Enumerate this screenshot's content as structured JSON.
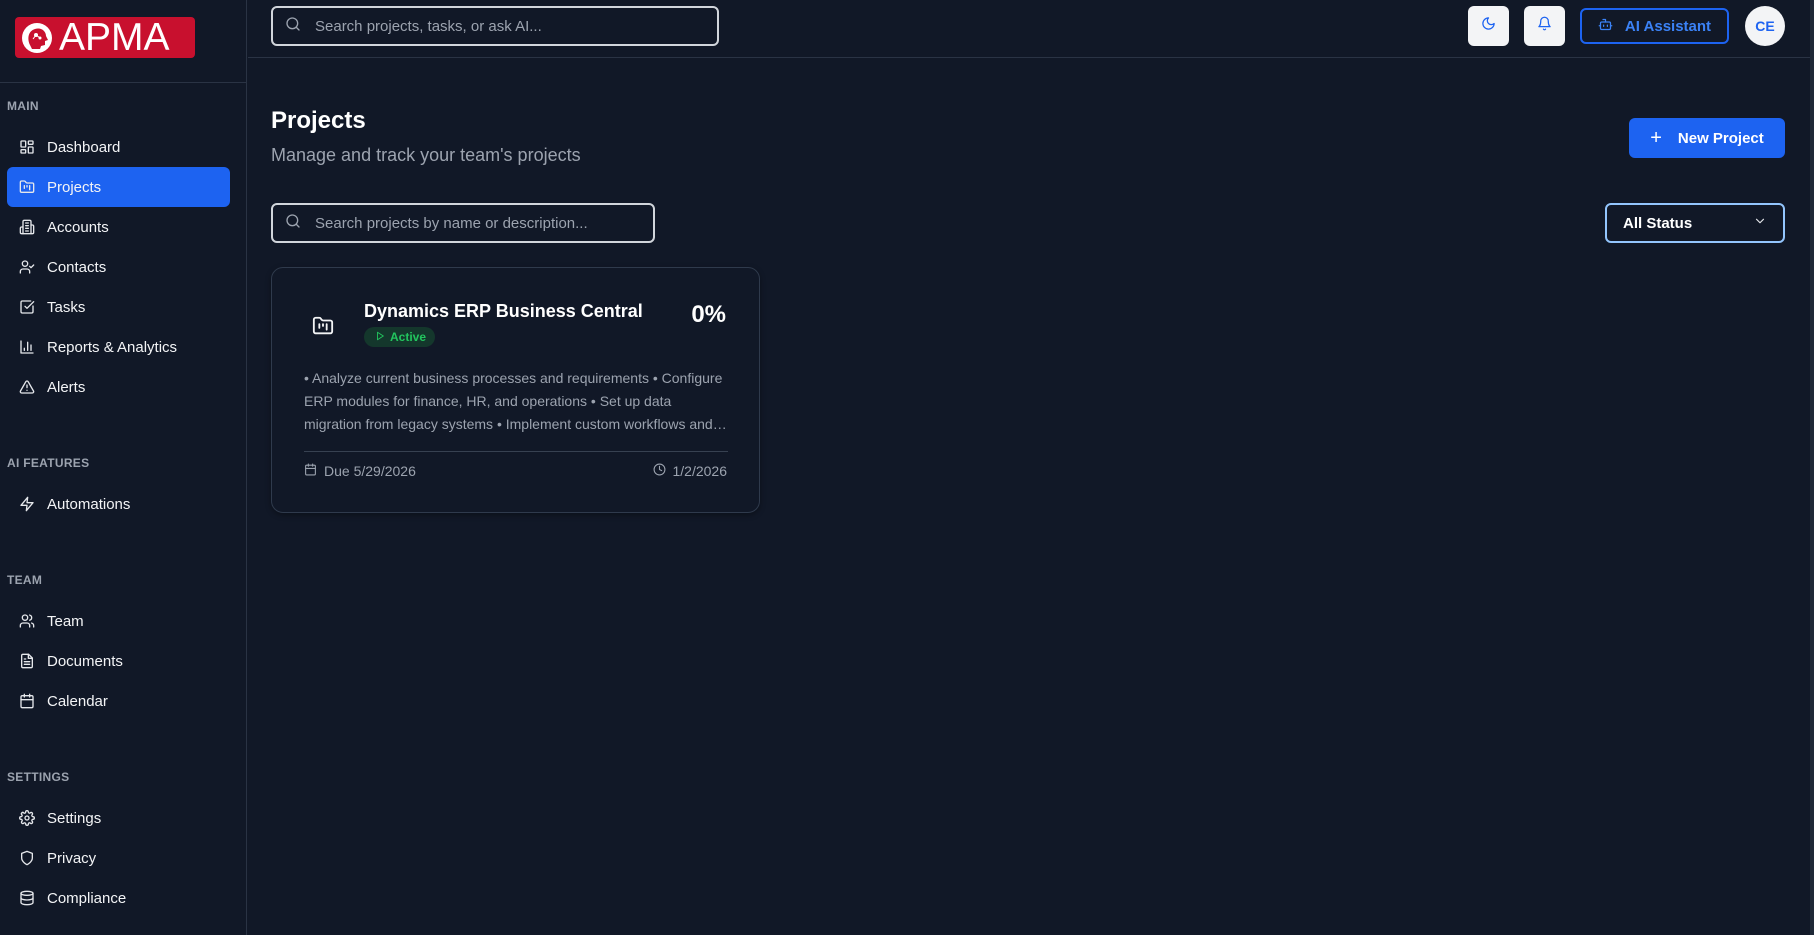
{
  "app": {
    "logo_text": "APMA"
  },
  "topbar": {
    "search_placeholder": "Search projects, tasks, or ask AI...",
    "ai_assistant_label": "AI Assistant",
    "avatar_initials": "CE"
  },
  "sidebar": {
    "sections": [
      {
        "label": "MAIN"
      },
      {
        "label": "AI FEATURES"
      },
      {
        "label": "TEAM"
      },
      {
        "label": "SETTINGS"
      }
    ],
    "items": [
      {
        "label": "Dashboard",
        "icon": "dashboard-icon",
        "active": false
      },
      {
        "label": "Projects",
        "icon": "folder-kanban-icon",
        "active": true
      },
      {
        "label": "Accounts",
        "icon": "building-icon",
        "active": false
      },
      {
        "label": "Contacts",
        "icon": "user-check-icon",
        "active": false
      },
      {
        "label": "Tasks",
        "icon": "checkbox-icon",
        "active": false
      },
      {
        "label": "Reports & Analytics",
        "icon": "bar-chart-icon",
        "active": false
      },
      {
        "label": "Alerts",
        "icon": "alert-triangle-icon",
        "active": false
      },
      {
        "label": "Automations",
        "icon": "zap-icon",
        "active": false
      },
      {
        "label": "Team",
        "icon": "users-icon",
        "active": false
      },
      {
        "label": "Documents",
        "icon": "file-text-icon",
        "active": false
      },
      {
        "label": "Calendar",
        "icon": "calendar-icon",
        "active": false
      },
      {
        "label": "Settings",
        "icon": "gear-icon",
        "active": false
      },
      {
        "label": "Privacy",
        "icon": "shield-icon",
        "active": false
      },
      {
        "label": "Compliance",
        "icon": "database-icon",
        "active": false
      }
    ]
  },
  "main": {
    "title": "Projects",
    "subtitle": "Manage and track your team's projects",
    "new_project_label": "New Project",
    "search_placeholder": "Search projects by name or description...",
    "status_filter": "All Status",
    "projects": [
      {
        "name": "Dynamics ERP Business Central",
        "progress": "0%",
        "status": "Active",
        "description": "• Analyze current business processes and requirements • Configure ERP modules for finance, HR, and operations • Set up data migration from legacy systems • Implement custom workflows and reporting • Train end users",
        "due": "Due 5/29/2026",
        "date": "1/2/2026"
      }
    ]
  },
  "colors": {
    "background": "#111827",
    "accent": "#1d63f1",
    "brand": "#c8102e",
    "active_status": "#22c55e"
  }
}
